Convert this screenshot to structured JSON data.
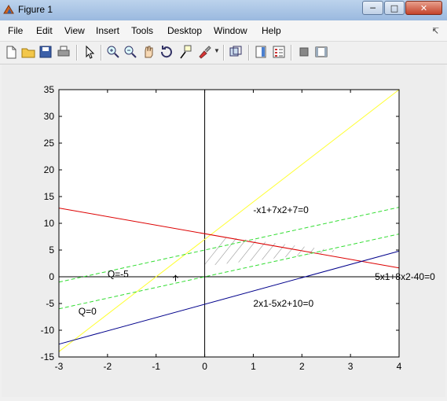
{
  "window": {
    "title": "Figure 1"
  },
  "menu": [
    "File",
    "Edit",
    "View",
    "Insert",
    "Tools",
    "Desktop",
    "Window",
    "Help"
  ],
  "toolbar_icons": [
    "new-figure-icon",
    "open-file-icon",
    "save-icon",
    "print-icon",
    "pointer-icon",
    "zoom-in-icon",
    "zoom-out-icon",
    "pan-icon",
    "rotate-3d-icon",
    "data-cursor-icon",
    "brush-icon",
    "link-plot-icon",
    "colorbar-icon",
    "legend-icon",
    "hide-plot-tools-icon",
    "show-plot-tools-icon"
  ],
  "chart_data": {
    "type": "line",
    "xlim": [
      -3,
      4
    ],
    "ylim": [
      -15,
      35
    ],
    "x_ticks": [
      "-3",
      "-2",
      "-1",
      "0",
      "1",
      "2",
      "3",
      "4"
    ],
    "y_ticks": [
      "35",
      "30",
      "25",
      "20",
      "15",
      "10",
      "5",
      "0",
      "-5",
      "-10",
      "-15"
    ],
    "grid": false,
    "series": [
      {
        "x": [
          -3,
          4
        ],
        "y": [
          -14,
          35
        ],
        "color": "#ffff33",
        "style": "solid"
      },
      {
        "x": [
          -3,
          4
        ],
        "y": [
          12.8571,
          1.6571
        ],
        "color": "#dd0000",
        "style": "solid"
      },
      {
        "x": [
          -3,
          4
        ],
        "y": [
          -12.6,
          4.8
        ],
        "color": "#00008b",
        "style": "solid"
      },
      {
        "x": [
          -3,
          4
        ],
        "y": [
          -1,
          13
        ],
        "color": "#33dd33",
        "style": "dashed"
      },
      {
        "x": [
          -3,
          4
        ],
        "y": [
          -6,
          8
        ],
        "color": "#33dd33",
        "style": "dashed"
      }
    ],
    "annotations": [
      {
        "text": "-x1+7x2+7=0",
        "x": 1.0,
        "y": 12.5
      },
      {
        "text": "5x1+8x2-40=0",
        "x": 3.5,
        "y": 0
      },
      {
        "text": "2x1-5x2+10=0",
        "x": 1.0,
        "y": -5
      },
      {
        "text": "Q=-5",
        "x": -2.0,
        "y": 0.5
      },
      {
        "text": "Q=0",
        "x": -2.6,
        "y": -6.5
      }
    ]
  }
}
